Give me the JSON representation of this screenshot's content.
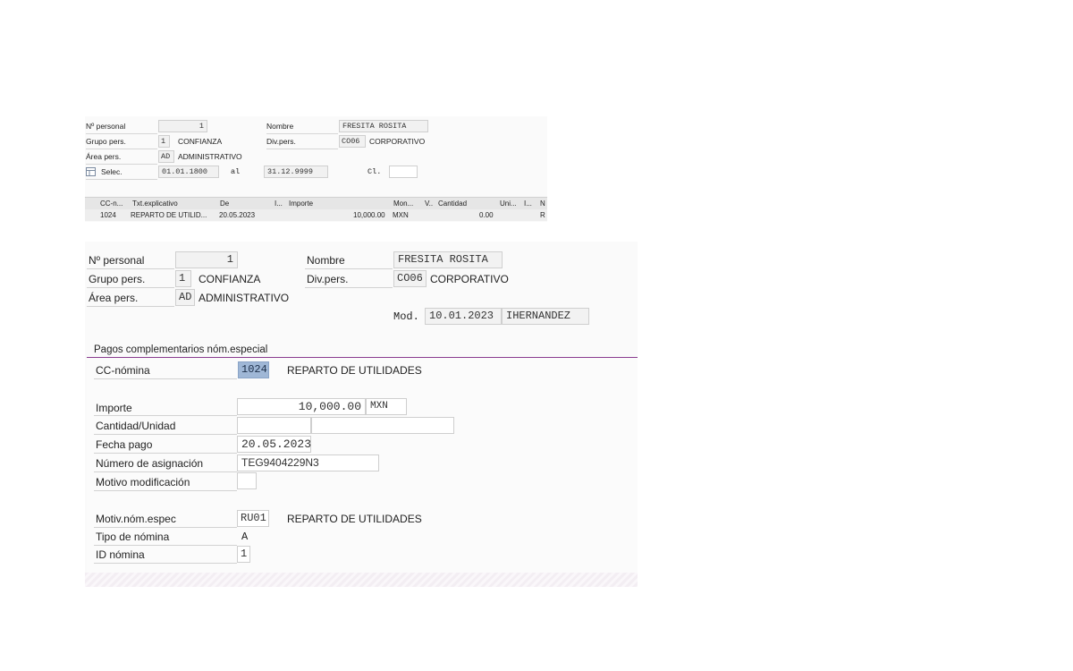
{
  "panel_small": {
    "nro_personal": {
      "label": "Nº personal",
      "value": "1"
    },
    "nombre": {
      "label": "Nombre",
      "value": "FRESITA ROSITA"
    },
    "grupo_pers": {
      "label": "Grupo pers.",
      "code": "1",
      "text": "CONFIANZA"
    },
    "div_pers": {
      "label": "Div.pers.",
      "code": "CO06",
      "text": "CORPORATIVO"
    },
    "area_pers": {
      "label": "Área pers.",
      "code": "AD",
      "text": "ADMINISTRATIVO"
    },
    "selec": {
      "label": "Selec.",
      "from": "01.01.1800",
      "to_label": "al",
      "to": "31.12.9999",
      "cl_label": "Cl.",
      "cl_value": ""
    },
    "table": {
      "headers": [
        "CC-n...",
        "Txt.explicativo",
        "De",
        "I...",
        "Importe",
        "Mon...",
        "V..",
        "Cantidad",
        "Uni...",
        "I...",
        "N"
      ],
      "rows": [
        [
          "1024",
          "REPARTO DE UTILID...",
          "20.05.2023",
          "",
          "10,000.00",
          "MXN",
          "",
          "0.00",
          "",
          "R",
          ""
        ]
      ]
    }
  },
  "panel_large": {
    "nro_personal": {
      "label": "Nº personal",
      "value": "1"
    },
    "nombre": {
      "label": "Nombre",
      "value": "FRESITA ROSITA"
    },
    "grupo_pers": {
      "label": "Grupo pers.",
      "code": "1",
      "text": "CONFIANZA"
    },
    "div_pers": {
      "label": "Div.pers.",
      "code": "CO06",
      "text": "CORPORATIVO"
    },
    "area_pers": {
      "label": "Área pers.",
      "code": "AD",
      "text": "ADMINISTRATIVO"
    },
    "mod": {
      "label": "Mod.",
      "date": "10.01.2023",
      "user": "IHERNANDEZ"
    },
    "section_title": "Pagos complementarios nóm.especial",
    "cc_nomina": {
      "label": "CC-nómina",
      "code": "1024",
      "text": "REPARTO DE UTILIDADES"
    },
    "importe": {
      "label": "Importe",
      "value": "10,000.00",
      "currency": "MXN"
    },
    "cantidad_unidad": {
      "label": "Cantidad/Unidad",
      "cantidad": "",
      "unidad": ""
    },
    "fecha_pago": {
      "label": "Fecha pago",
      "value": "20.05.2023"
    },
    "numero_asignacion": {
      "label": "Número de asignación",
      "value": "TEG9404229N3"
    },
    "motivo_modificacion": {
      "label": "Motivo modificación",
      "value": ""
    },
    "motiv_nom_espec": {
      "label": "Motiv.nóm.espec",
      "code": "RU01",
      "text": "REPARTO DE UTILIDADES"
    },
    "tipo_nomina": {
      "label": "Tipo de nómina",
      "value": "A"
    },
    "id_nomina": {
      "label": "ID nómina",
      "value": "1"
    }
  }
}
